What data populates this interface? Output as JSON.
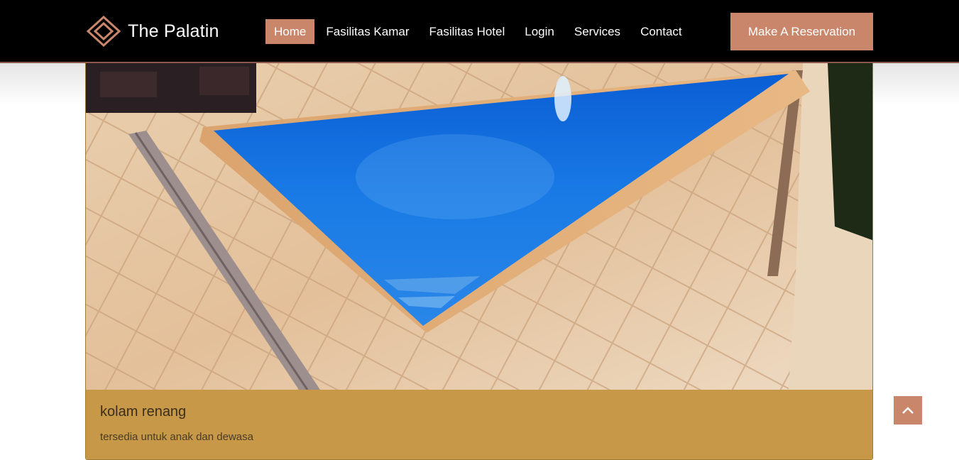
{
  "brand": {
    "name": "The Palatin",
    "logo_icon": "diamond-logo-icon"
  },
  "nav": {
    "items": [
      {
        "label": "Home",
        "active": true
      },
      {
        "label": "Fasilitas Kamar",
        "active": false
      },
      {
        "label": "Fasilitas Hotel",
        "active": false
      },
      {
        "label": "Login",
        "active": false
      },
      {
        "label": "Services",
        "active": false
      },
      {
        "label": "Contact",
        "active": false
      }
    ],
    "cta_label": "Make A Reservation"
  },
  "facility": {
    "image_icon": "swimming-pool-photo",
    "title": "kolam renang",
    "description": "tersedia untuk anak dan dewasa"
  },
  "back_to_top": {
    "icon": "chevron-up-icon"
  },
  "colors": {
    "navbar_bg": "#000000",
    "accent": "#c9866b",
    "card_body": "#c79848",
    "pool_water": "#1a6fd9"
  }
}
